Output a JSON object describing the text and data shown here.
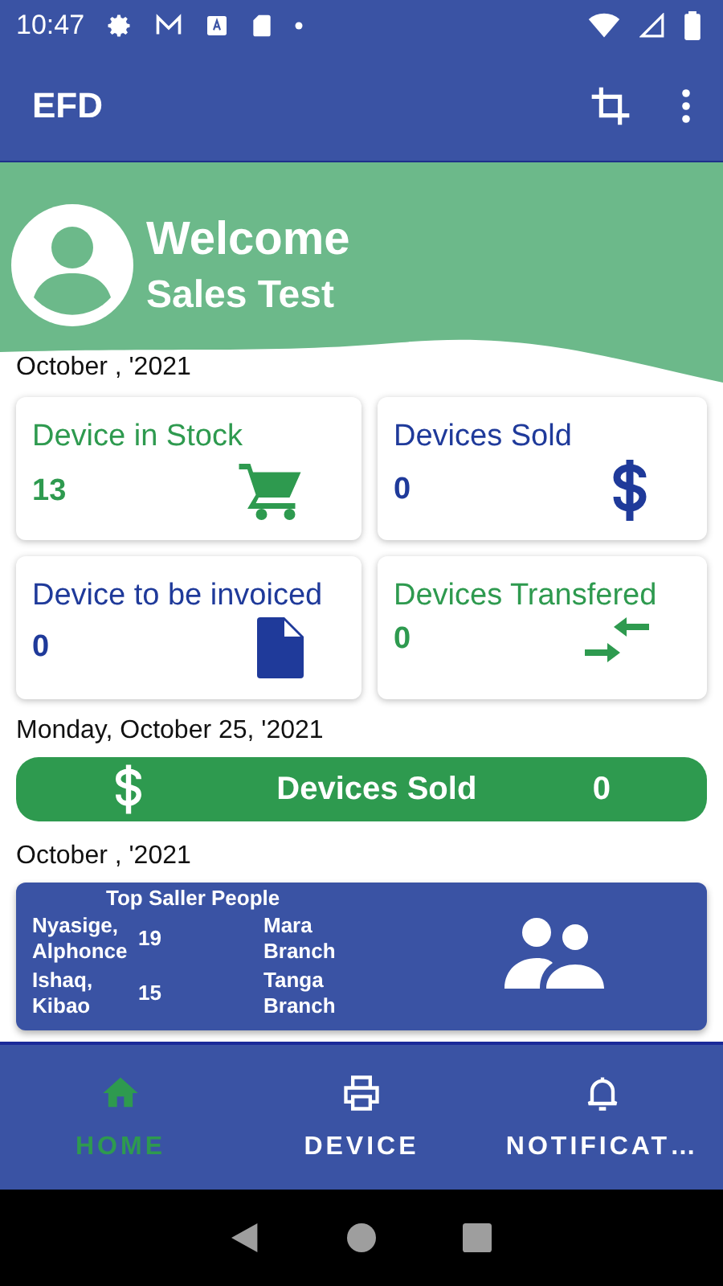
{
  "status_bar": {
    "time": "10:47"
  },
  "app_bar": {
    "title": "EFD"
  },
  "header": {
    "greeting": "Welcome",
    "user": "Sales Test"
  },
  "period": "October , '2021",
  "cards": [
    {
      "title": "Device in Stock",
      "value": "13",
      "color": "#2e9a4f"
    },
    {
      "title": "Devices Sold",
      "value": "0",
      "color": "#1f3a9a"
    },
    {
      "title": "Device to be invoiced",
      "value": "0",
      "color": "#1f3a9a"
    },
    {
      "title": "Devices Transfered",
      "value": "0",
      "color": "#2e9a4f"
    }
  ],
  "daily": {
    "date": "Monday, October 25, '2021",
    "label": "Devices Sold",
    "value": "0"
  },
  "top_period": "October , '2021",
  "top_sellers": {
    "title": "Top Saller People",
    "rows": [
      {
        "name": "Nyasige, Alphonce",
        "count": "19",
        "branch": "Mara Branch"
      },
      {
        "name": "Ishaq, Kibao",
        "count": "15",
        "branch": "Tanga Branch"
      }
    ]
  },
  "bottom_nav": [
    {
      "label": "HOME",
      "selected": true
    },
    {
      "label": "DEVICE",
      "selected": false
    },
    {
      "label": "NOTIFICAT…",
      "selected": false
    }
  ]
}
